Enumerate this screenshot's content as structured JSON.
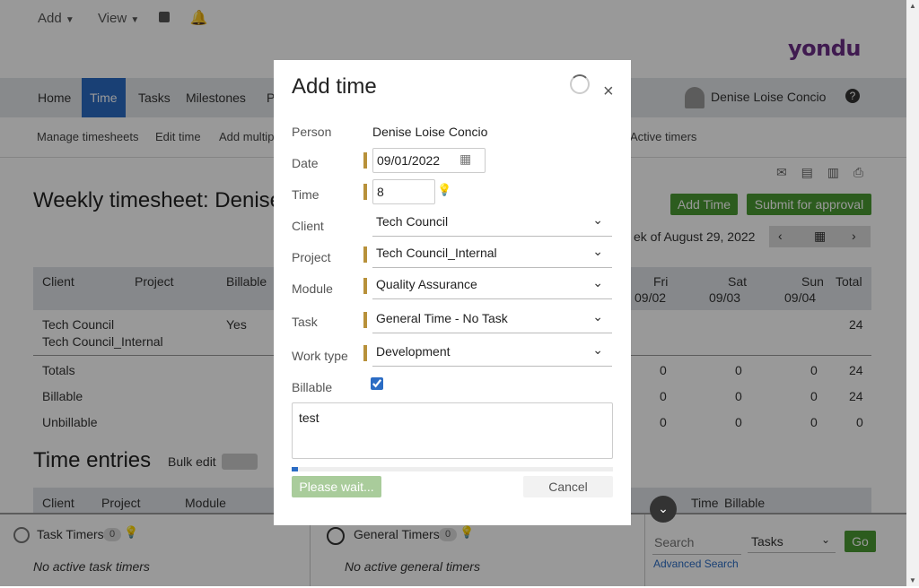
{
  "top_menu": {
    "add_label": "Add",
    "view_label": "View"
  },
  "brand": {
    "logo_text": "yondu",
    "accent": "#6b2d86"
  },
  "nav": {
    "items": [
      {
        "label": "Home"
      },
      {
        "label": "Time"
      },
      {
        "label": "Tasks"
      },
      {
        "label": "Milestones"
      },
      {
        "label": "P"
      }
    ],
    "user_name": "Denise Loise Concio"
  },
  "subnav": {
    "items": [
      "Manage timesheets",
      "Edit time",
      "Add multip",
      "Active timers"
    ]
  },
  "page": {
    "title": "Weekly timesheet:  Denise",
    "add_time_label": "Add Time",
    "submit_label": "Submit for approval",
    "week_label": "ek of August 29, 2022"
  },
  "grid": {
    "headers": [
      "Client",
      "Project",
      "Billable"
    ],
    "day_headers": [
      {
        "day": "Fri",
        "date": "09/02"
      },
      {
        "day": "Sat",
        "date": "09/03"
      },
      {
        "day": "Sun",
        "date": "09/04"
      }
    ],
    "total_header": "Total",
    "row": {
      "client": "Tech Council",
      "project": "Tech Council_Internal",
      "billable": "Yes",
      "total": "24"
    },
    "summary": [
      {
        "label": "Totals",
        "values": [
          "0",
          "0",
          "0",
          "24"
        ]
      },
      {
        "label": "Billable",
        "values": [
          "0",
          "0",
          "0",
          "24"
        ]
      },
      {
        "label": "Unbillable",
        "values": [
          "0",
          "0",
          "0",
          "0"
        ]
      }
    ]
  },
  "entries": {
    "title": "Time entries",
    "bulk_edit_label": "Bulk edit",
    "headers": [
      "Client",
      "Project",
      "Module",
      "Time",
      "Billable"
    ]
  },
  "footer": {
    "task_timers_label": "Task Timers",
    "task_timers_count": "0",
    "no_task_timers": "No active task timers",
    "general_timers_label": "General Timers",
    "general_timers_count": "0",
    "no_general_timers": "No active general timers",
    "search_placeholder": "Search",
    "search_scope": "Tasks",
    "go_label": "Go",
    "advanced_search": "Advanced Search"
  },
  "modal": {
    "title": "Add time",
    "person_label": "Person",
    "person_value": "Denise Loise Concio",
    "date_label": "Date",
    "date_value": "09/01/2022",
    "time_label": "Time",
    "time_value": "8",
    "client_label": "Client",
    "client_value": "Tech Council",
    "project_label": "Project",
    "project_value": "Tech Council_Internal",
    "module_label": "Module",
    "module_value": "Quality Assurance",
    "task_label": "Task",
    "task_value": "General Time - No Task",
    "worktype_label": "Work type",
    "worktype_value": "Development",
    "billable_label": "Billable",
    "billable_checked": true,
    "notes_value": "test",
    "progress_percent": 2,
    "submit_label": "Please wait...",
    "cancel_label": "Cancel"
  }
}
